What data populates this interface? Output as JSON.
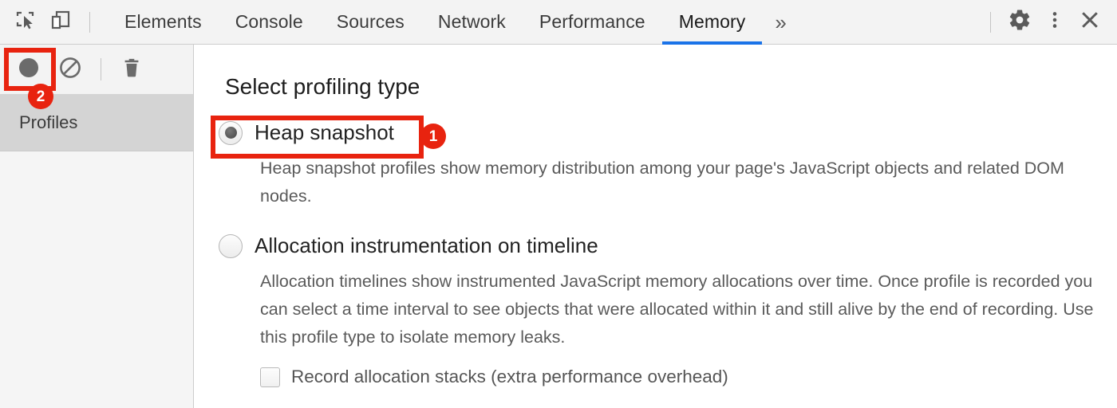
{
  "tabbar": {
    "left_icons": [
      {
        "name": "inspect-element-icon",
        "label": "Inspect element"
      },
      {
        "name": "device-toolbar-icon",
        "label": "Toggle device toolbar"
      }
    ],
    "tabs": [
      {
        "label": "Elements",
        "active": false
      },
      {
        "label": "Console",
        "active": false
      },
      {
        "label": "Sources",
        "active": false
      },
      {
        "label": "Network",
        "active": false
      },
      {
        "label": "Performance",
        "active": false
      },
      {
        "label": "Memory",
        "active": true
      }
    ],
    "more_tabs_label": "»",
    "right_icons": [
      {
        "name": "gear-icon",
        "label": "Settings"
      },
      {
        "name": "kebab-menu-icon",
        "label": "Customize and control DevTools"
      },
      {
        "name": "close-icon",
        "label": "Close DevTools"
      }
    ],
    "active_tab_underline_color": "#1a73e8"
  },
  "sidebar": {
    "toolbar": [
      {
        "name": "record-button",
        "label": "Start/stop recording heap profile"
      },
      {
        "name": "clear-button",
        "label": "Clear all profiles"
      },
      {
        "name": "delete-button",
        "label": "Delete profile"
      }
    ],
    "sections": [
      {
        "label": "Profiles",
        "selected": true
      }
    ]
  },
  "main": {
    "heading": "Select profiling type",
    "options": [
      {
        "id": "heap-snapshot",
        "label": "Heap snapshot",
        "selected": true,
        "description": "Heap snapshot profiles show memory distribution among your page's JavaScript objects and related DOM nodes."
      },
      {
        "id": "allocation-instrumentation",
        "label": "Allocation instrumentation on timeline",
        "selected": false,
        "description": "Allocation timelines show instrumented JavaScript memory allocations over time. Once profile is recorded you can select a time interval to see objects that were allocated within it and still alive by the end of recording. Use this profile type to isolate memory leaks."
      }
    ],
    "checkbox": {
      "label": "Record allocation stacks (extra performance overhead)",
      "checked": false
    }
  },
  "annotations": {
    "color": "#e8230f",
    "items": [
      {
        "id": "annot-heap-snapshot",
        "badge": "1",
        "target": "heap-snapshot-option"
      },
      {
        "id": "annot-record-button",
        "badge": "2",
        "target": "record-button"
      }
    ]
  }
}
